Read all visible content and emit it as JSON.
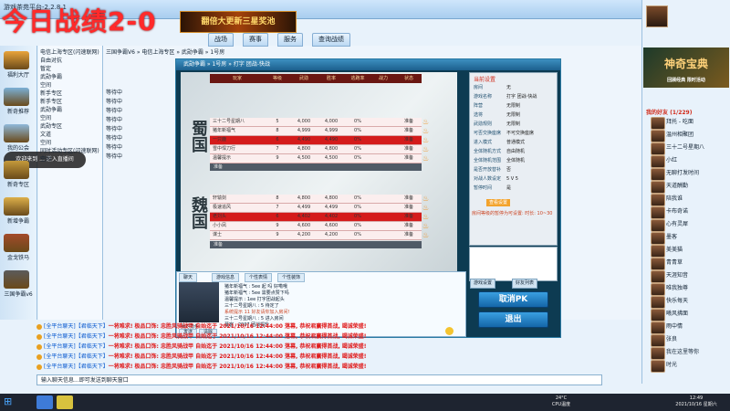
{
  "app": {
    "name": "游戏茶苑平台-2.2.8.1",
    "overlay_title": "今日战绩2-0"
  },
  "promo": {
    "text": "翻倍大更新三星奖池"
  },
  "top_tabs": [
    "战场",
    "赛事",
    "服务",
    "查询战绩"
  ],
  "left_strip": {
    "items": [
      {
        "label": "福利大厅",
        "color": "#e9a43a"
      },
      {
        "label": "新奇推荐",
        "color": "#7bb0d6"
      },
      {
        "label": "我的公会",
        "color": "#8fb9db"
      },
      {
        "label": "新奇专区",
        "color": "#c59a3b"
      },
      {
        "label": "新增争霸",
        "color": "#ddb04a"
      },
      {
        "label": "金戈铁马",
        "color": "#a34b2b"
      },
      {
        "label": "三国争霸v6",
        "color": "#5b5b5b"
      }
    ]
  },
  "left_list": {
    "rows": [
      "电信上海专区(闪速联网)",
      "自由对抗",
      "暂定",
      "武勋争霸",
      "空间",
      "新手专区",
      "新手专区",
      "武勋争霸",
      "空间",
      "武勋专区",
      "文道",
      "空间",
      "同时活动专区(闪速联网)",
      "空间"
    ]
  },
  "toast": {
    "text": "欢迎来到 ... 进入直播间"
  },
  "center_panel": {
    "breadcrumb": "三国争霸V6 » 电信上海专区 » 武勋争霸 » 1号房",
    "rows": [
      "等待中",
      "等待中",
      "等待中",
      "等待中",
      "等待中",
      "等待中",
      "等待中",
      "等待中"
    ]
  },
  "game": {
    "window_title": "武勋争霸 » 1号房 » 打字 团战-快战",
    "factions": [
      "蜀国",
      "魏国"
    ],
    "table_headers": [
      "玩家",
      "等级",
      "武勋",
      "胜率",
      "逃跑率",
      "战力",
      "状态"
    ],
    "shu_players": [
      {
        "name": "三十二号星期八",
        "lv": "5",
        "wx": "4,000",
        "wr": "4,000",
        "esc": "0%",
        "pw": "",
        "st": "准备"
      },
      {
        "name": "猪年新福气",
        "lv": "8",
        "wx": "4,999",
        "wr": "4,999",
        "esc": "0%",
        "pw": "",
        "st": "准备"
      },
      {
        "name": "一只鹿",
        "lv": "6",
        "wx": "4,490",
        "wr": "4,490",
        "esc": "0%",
        "pw": "",
        "st": "准备"
      },
      {
        "name": "雪中悍刀行",
        "lv": "7",
        "wx": "4,800",
        "wr": "4,800",
        "esc": "0%",
        "pw": "",
        "st": "准备"
      },
      {
        "name": "温馨提示",
        "lv": "9",
        "wx": "4,500",
        "wr": "4,500",
        "esc": "0%",
        "pw": "",
        "st": "准备"
      }
    ],
    "shu_footer": "准备",
    "wei_players": [
      {
        "name": "轩辕剑",
        "lv": "8",
        "wx": "4,800",
        "wr": "4,800",
        "esc": "0%",
        "pw": "",
        "st": "准备"
      },
      {
        "name": "极速追风",
        "lv": "7",
        "wx": "4,499",
        "wr": "4,499",
        "esc": "0%",
        "pw": "",
        "st": "准备"
      },
      {
        "name": "老刘头",
        "lv": "6",
        "wx": "4,402",
        "wr": "4,402",
        "esc": "0%",
        "pw": "",
        "st": "准备"
      },
      {
        "name": "小小凤",
        "lv": "9",
        "wx": "4,600",
        "wr": "4,600",
        "esc": "0%",
        "pw": "",
        "st": "准备"
      },
      {
        "name": "谋士",
        "lv": "9",
        "wx": "4,200",
        "wr": "4,200",
        "esc": "0%",
        "pw": "",
        "st": "准备"
      }
    ],
    "wei_footer": "准备"
  },
  "settings": {
    "title": "当前设置",
    "rows": [
      {
        "k": "房间",
        "v": "无"
      },
      {
        "k": "游戏名称",
        "v": "打字 团战-快战"
      },
      {
        "k": "阵营",
        "v": "无限制"
      },
      {
        "k": "选将",
        "v": "无限制"
      },
      {
        "k": "武勋规则",
        "v": "无限制"
      },
      {
        "k": "可否交换座席",
        "v": "不可交换座席"
      },
      {
        "k": "进入模式",
        "v": "普通模式"
      },
      {
        "k": "全体随机方式",
        "v": "自由随机"
      },
      {
        "k": "全体随机范围",
        "v": "全体随机"
      },
      {
        "k": "是否开放替补",
        "v": "否"
      },
      {
        "k": "对战人数设定",
        "v": "5 V 5"
      },
      {
        "k": "暂停时间",
        "v": "是"
      }
    ],
    "link": "查看设置",
    "hint": "房间等级的暂停为可设置: 时长: 10~30"
  },
  "game_tabs": [
    "游戏设置",
    "好友列表"
  ],
  "buttons": {
    "cancel_ready": "取消PK",
    "exit": "退出"
  },
  "chat": {
    "tabs": [
      "聊天",
      "游戏信息",
      "个性表情",
      "个性装饰"
    ],
    "avatar_name": "我的角色",
    "lines": [
      "猪年新福气 : 5ee    起 吗 好嘞哦",
      "猪年新福气 : 5ee    需要点赞下吗",
      "温馨提示 : 1ee    打字团战起头",
      "三十二号星期八 : 5  待定了",
      "系统提示 11 好友请你加入房间!",
      "三十二号星期八 : 5  进入房间",
      "幕客 : 2007  团战提升"
    ],
    "btn_a": "发送",
    "btn_b": "清除"
  },
  "bottom_lines": [
    {
      "tag": "[全平台聊天]",
      "user": "【君临天下】",
      "text": "一将难求! 极品口饰: 忠胜风骑战甲 自始迄于 2021/10/16 12:44:00 落幕, 恭祝君赢得首战, 竭诚荣盛!"
    },
    {
      "tag": "[全平台聊天]",
      "user": "【君临天下】",
      "text": "一将难求! 极品口饰: 忠胜风骑战甲 自始迄于 2021/10/16 12:44:00 落幕, 恭祝君赢得首战, 竭诚荣盛!"
    },
    {
      "tag": "[全平台聊天]",
      "user": "【君临天下】",
      "text": "一将难求! 极品口饰: 忠胜风骑战甲 自始迄于 2021/10/16 12:44:00 落幕, 恭祝君赢得首战, 竭诚荣盛!"
    },
    {
      "tag": "[全平台聊天]",
      "user": "【君临天下】",
      "text": "一将难求! 极品口饰: 忠胜风骑战甲 自始迄于 2021/10/16 12:44:00 落幕, 恭祝君赢得首战, 竭诚荣盛!"
    },
    {
      "tag": "[全平台聊天]",
      "user": "【君临天下】",
      "text": "一将难求! 极品口饰: 忠胜风骑战甲 自始迄于 2021/10/16 12:44:00 落幕, 恭祝君赢得首战, 竭诚荣盛!"
    }
  ],
  "input_placeholder": "输入聊天信息...即可发送到聊天窗口",
  "right_panel": {
    "ad_text": "神奇宝典",
    "ad_sub": "回顾经典 限时活动",
    "section": "我的好友 (1/229)",
    "friends": [
      "拜托 - 吃面",
      "温州相聚团",
      "三十二号星期八",
      "小红",
      "无聊打发时间",
      "天道酬勤",
      "陪我谁",
      "卡布奇诺",
      "心有灵犀",
      "墨客",
      "美美猫",
      "青青草",
      "天涯知音",
      "唯我独尊",
      "快乐每天",
      "曦风拂面",
      "雨中情",
      "张良",
      "我在这里等你",
      "时光"
    ]
  },
  "taskbar": {
    "temp": "24°C",
    "temp_sub": "CPU温度",
    "time": "12:49",
    "date": "2021/10/16 星期六"
  }
}
